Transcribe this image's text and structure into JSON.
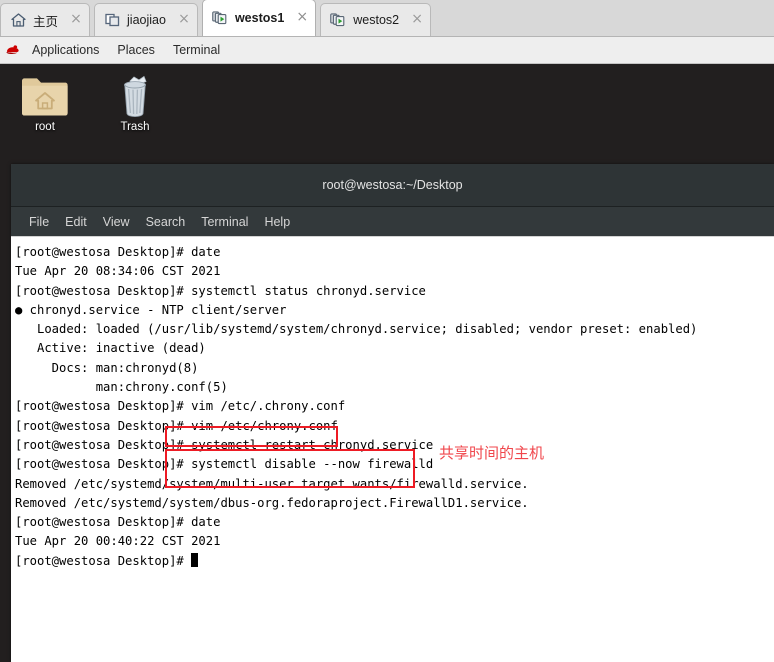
{
  "tabs": [
    {
      "label": "主页",
      "icon": "home-icon",
      "active": false,
      "close": "×"
    },
    {
      "label": "jiaojiao",
      "icon": "windows-stack-icon",
      "active": false,
      "close": "×"
    },
    {
      "label": "westos1",
      "icon": "vm-running-icon",
      "active": true,
      "close": "×"
    },
    {
      "label": "westos2",
      "icon": "vm-running-icon",
      "active": false,
      "close": "×"
    }
  ],
  "panel": {
    "logo": "redhat-shadowman-icon",
    "items": [
      "Applications",
      "Places",
      "Terminal"
    ]
  },
  "desktop": {
    "icons": [
      {
        "label": "root",
        "icon": "home-folder-icon"
      },
      {
        "label": "Trash",
        "icon": "trash-can-icon"
      }
    ]
  },
  "terminal": {
    "title": "root@westosa:~/Desktop",
    "menu": [
      "File",
      "Edit",
      "View",
      "Search",
      "Terminal",
      "Help"
    ],
    "prompt": "[root@westosa Desktop]# ",
    "lines": [
      {
        "text": "[root@westosa Desktop]# date"
      },
      {
        "text": "Tue Apr 20 08:34:06 CST 2021"
      },
      {
        "text": "[root@westosa Desktop]# systemctl status chronyd.service"
      },
      {
        "text": "● chronyd.service - NTP client/server"
      },
      {
        "text": "   Loaded: loaded (/usr/lib/systemd/system/chronyd.service; disabled; vendor preset: enabled)"
      },
      {
        "text": "   Active: inactive (dead)"
      },
      {
        "text": "     Docs: man:chronyd(8)"
      },
      {
        "text": "           man:chrony.conf(5)"
      },
      {
        "text": "[root@westosa Desktop]# vim /etc/.chrony.conf"
      },
      {
        "text": "[root@westosa Desktop]# vim /etc/chrony.conf"
      },
      {
        "text": "[root@westosa Desktop]# systemctl restart chronyd.service"
      },
      {
        "text": "[root@westosa Desktop]# systemctl disable --now firewalld"
      },
      {
        "text": "Removed /etc/systemd/system/multi-user.target.wants/firewalld.service."
      },
      {
        "text": "Removed /etc/systemd/system/dbus-org.fedoraproject.FirewallD1.service."
      },
      {
        "text": "[root@westosa Desktop]# date"
      },
      {
        "text": "Tue Apr 20 00:40:22 CST 2021"
      },
      {
        "text": "[root@westosa Desktop]# "
      }
    ]
  },
  "annotations": {
    "note_cn": "共享时间的主机",
    "note_color": "#f0474c",
    "box_color": "#ee1b24",
    "boxed_commands": [
      "vim /etc/chrony.conf",
      "systemctl restart chronyd.service",
      "systemctl disable --now firewalld"
    ]
  },
  "colors": {
    "tabstrip_bg": "#d8d8d8",
    "panel_bg": "#eeeeee",
    "desktop_bg": "#221f1f",
    "terminal_titlebar": "#2e3436",
    "terminal_menubar": "#33393b",
    "terminal_bg": "#ffffff",
    "terminal_fg": "#000000",
    "redhat_logo": "#cc0000"
  }
}
